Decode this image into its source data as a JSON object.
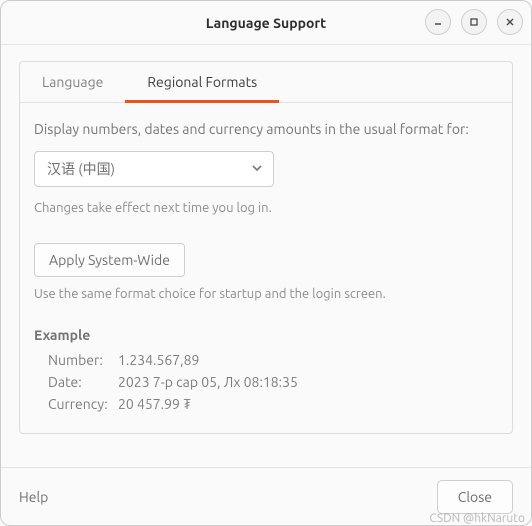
{
  "window": {
    "title": "Language Support"
  },
  "tabs": {
    "language": "Language",
    "regional": "Regional Formats"
  },
  "panel": {
    "desc": "Display numbers, dates and currency amounts in the usual format for:",
    "locale_selected": "汉语 (中国)",
    "hint_restart": "Changes take effect next time you log in.",
    "apply_label": "Apply System-Wide",
    "hint_system": "Use the same format choice for startup and the login screen."
  },
  "example": {
    "heading": "Example",
    "number_label": "Number:",
    "number_value": "1.234.567,89",
    "date_label": "Date:",
    "date_value": "2023 7-р сар 05, Лх 08:18:35",
    "currency_label": "Currency:",
    "currency_value": "20 457.99 ₮"
  },
  "footer": {
    "help": "Help",
    "close": "Close"
  },
  "watermark": "CSDN @hkNaruto"
}
